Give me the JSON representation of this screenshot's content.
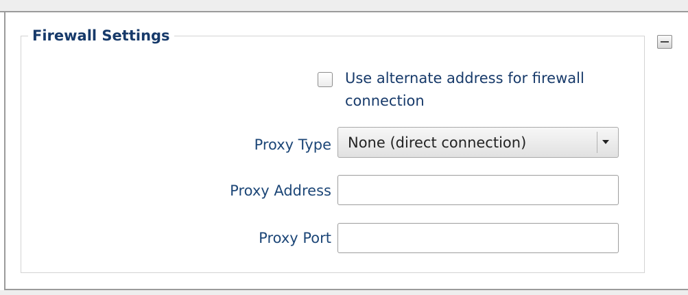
{
  "panel": {
    "title": "Firewall Settings"
  },
  "icons": {
    "collapse": "minus-icon"
  },
  "alternate_address": {
    "label": "Use alternate address for firewall connection",
    "checked": false
  },
  "proxy_type": {
    "label": "Proxy Type",
    "value": "None (direct connection)"
  },
  "proxy_address": {
    "label": "Proxy Address",
    "value": "",
    "placeholder": ""
  },
  "proxy_port": {
    "label": "Proxy Port",
    "value": "",
    "placeholder": ""
  },
  "colors": {
    "title": "#173a6a",
    "label": "#1c4677",
    "border": "#d3d3d3"
  }
}
